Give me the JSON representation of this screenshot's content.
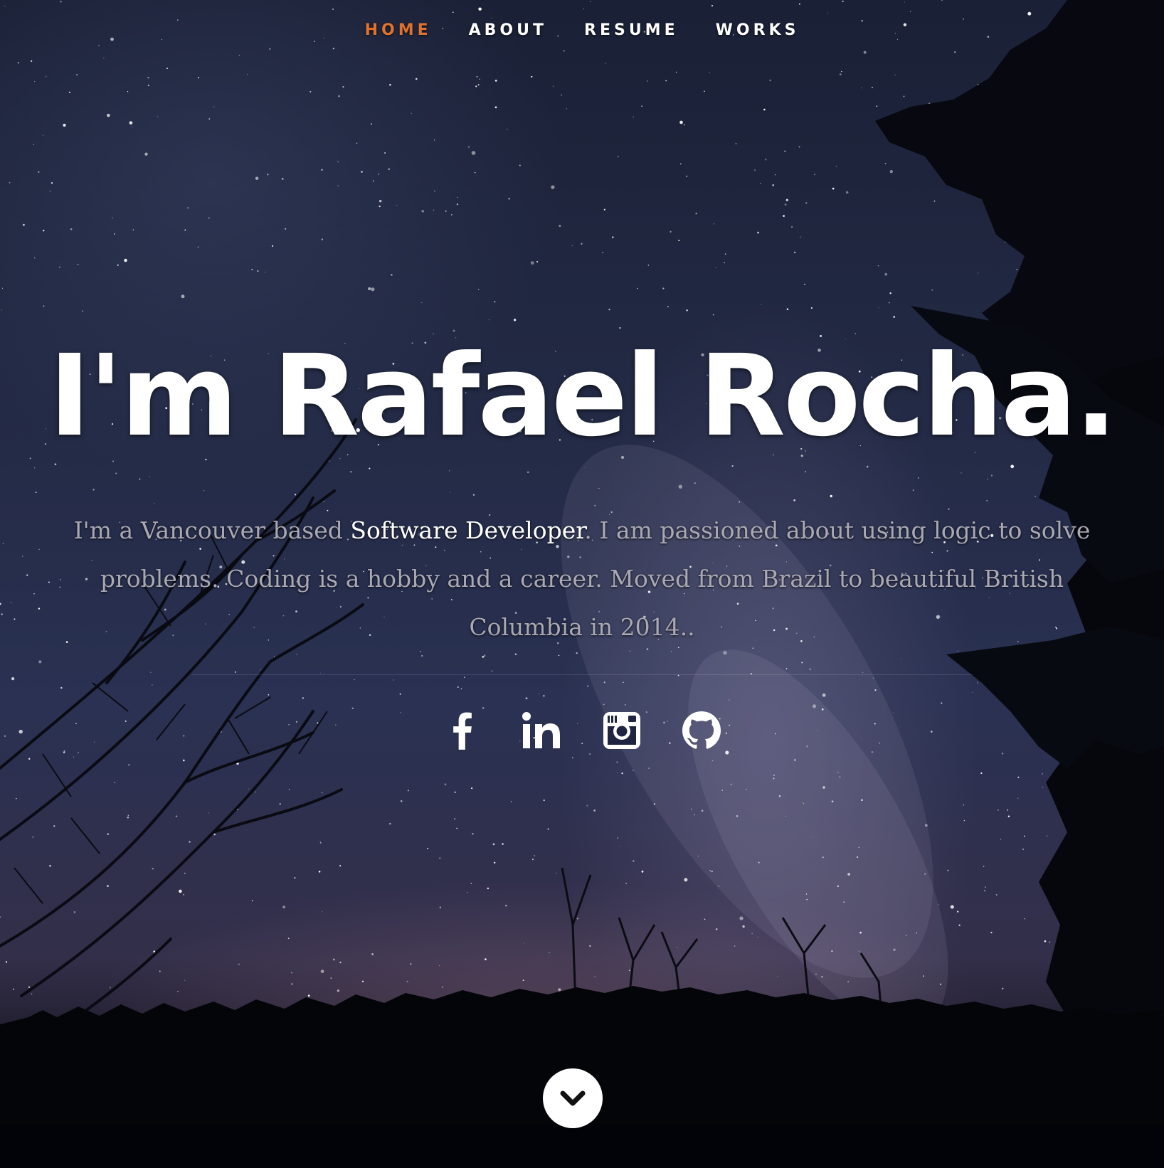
{
  "nav": {
    "items": [
      {
        "label": "HOME",
        "active": true
      },
      {
        "label": "ABOUT",
        "active": false
      },
      {
        "label": "RESUME",
        "active": false
      },
      {
        "label": "WORKS",
        "active": false
      }
    ],
    "active_color": "#e0722e"
  },
  "hero": {
    "headline": "I'm Rafael Rocha.",
    "intro_before": "I'm a Vancouver based ",
    "intro_highlight": "Software Developer",
    "intro_after": ". I am passioned about using logic to solve problems. Coding is a hobby and a career. Moved from Brazil to beautiful British Columbia in 2014.."
  },
  "social": [
    {
      "name": "facebook-icon"
    },
    {
      "name": "linkedin-icon"
    },
    {
      "name": "instagram-icon"
    },
    {
      "name": "github-icon"
    }
  ],
  "scroll": {
    "icon": "chevron-down-icon"
  }
}
